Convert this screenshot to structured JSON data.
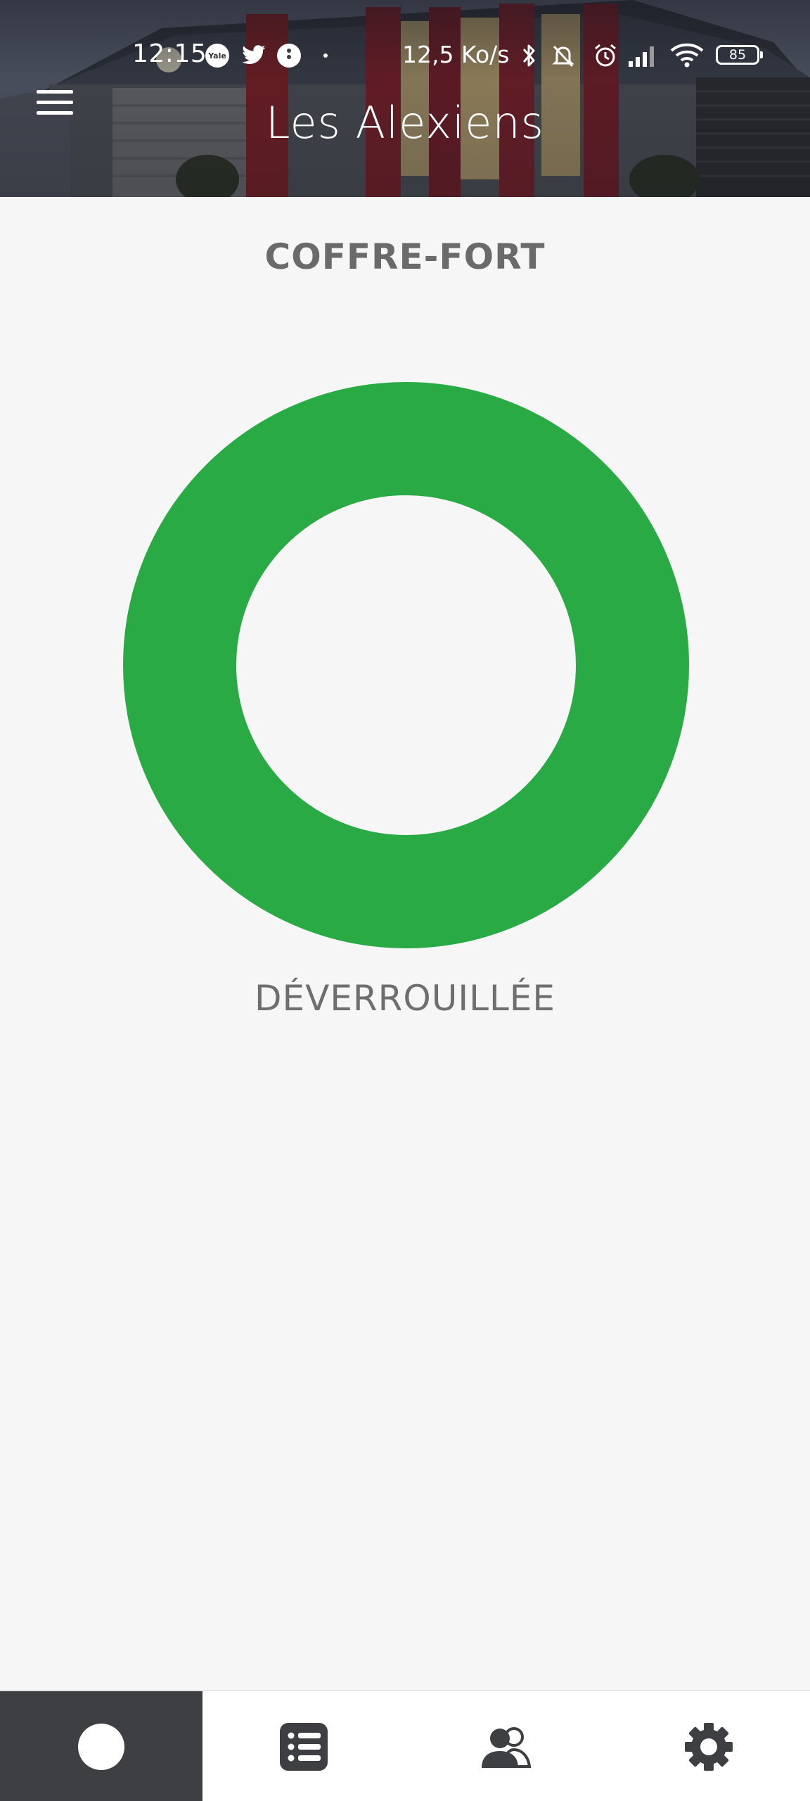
{
  "status_bar": {
    "time": "12:15",
    "network_speed": "12,5 Ko/s",
    "battery_level": "85",
    "notification_icons": [
      "yale-app-icon",
      "twitter-icon",
      "info-icon",
      "dot-icon"
    ],
    "system_icons": [
      "bluetooth-icon",
      "bell-muted-icon",
      "alarm-icon",
      "signal-icon",
      "wifi-icon",
      "battery-icon"
    ],
    "yale_badge": "Yale"
  },
  "header": {
    "title": "Les Alexiens",
    "menu_icon": "hamburger-menu-icon"
  },
  "lock": {
    "name": "COFFRE-FORT",
    "status": "DÉVERROUILLÉE",
    "status_color": "#2aaa44"
  },
  "bottom_nav": {
    "active_index": 0,
    "items": [
      {
        "icon": "lock-circle-icon"
      },
      {
        "icon": "activity-list-icon"
      },
      {
        "icon": "guests-icon"
      },
      {
        "icon": "settings-gear-icon"
      }
    ]
  },
  "colors": {
    "background": "#f6f6f6",
    "nav_active": "#3e3f42",
    "text_gray": "#6a6a6a",
    "accent_green": "#2aaa44"
  }
}
